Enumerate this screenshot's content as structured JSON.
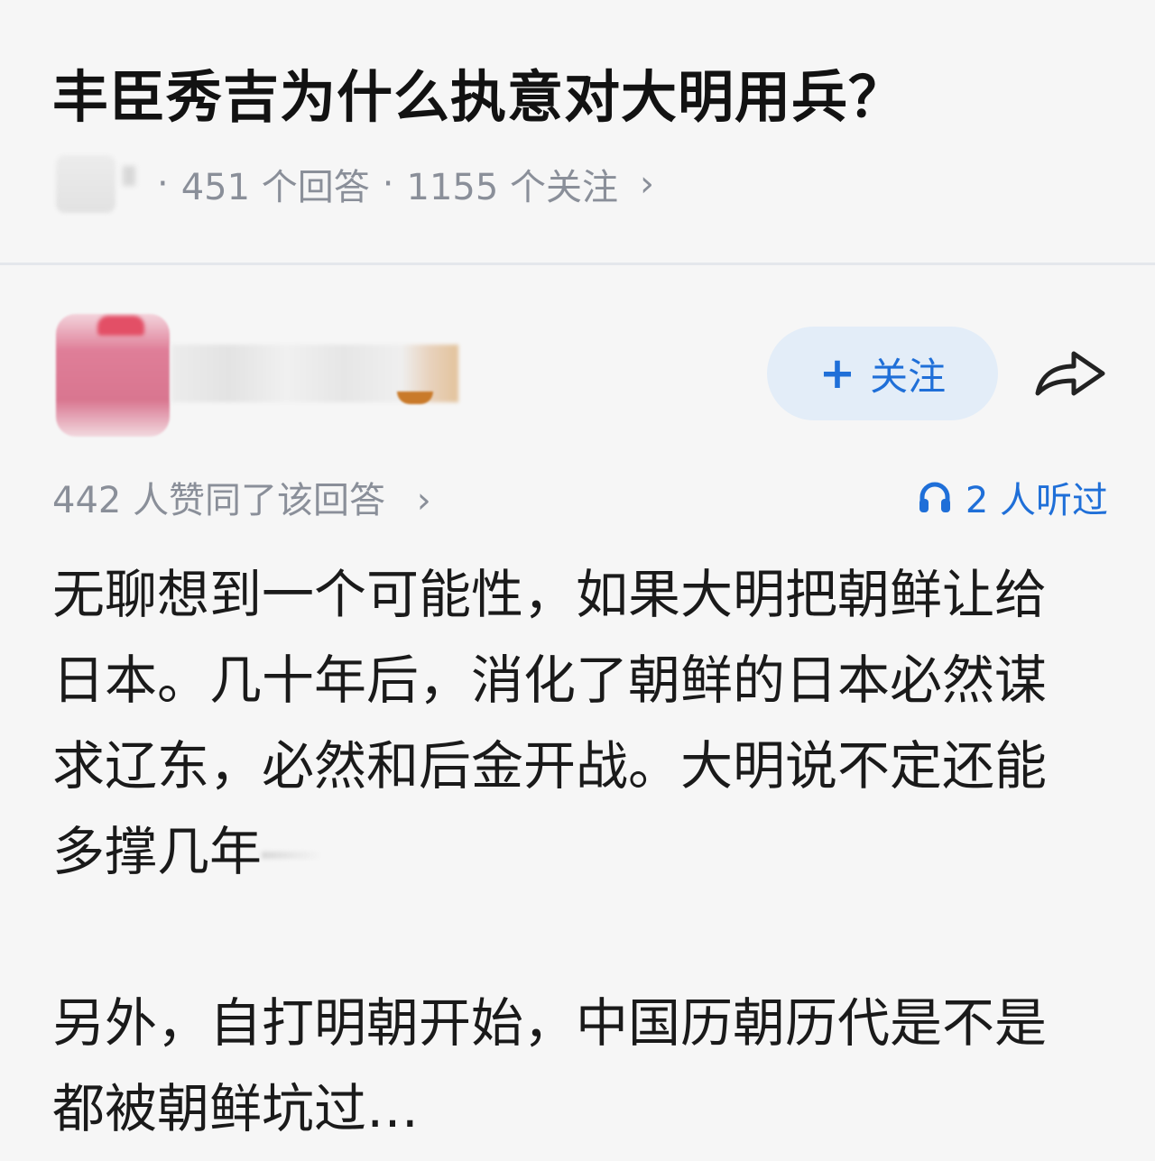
{
  "question": {
    "title": "丰臣秀吉为什么执意对大明用兵？",
    "answer_count": "451 个回答",
    "follow_count": "1155 个关注",
    "separator": "·",
    "chevron": "›"
  },
  "answer": {
    "follow_label": "关注",
    "likes_text": "442 人赞同了该回答",
    "likes_chevron": "›",
    "listened_text": "2 人听过",
    "paragraphs": [
      "无聊想到一个可能性，如果大明把朝鲜让给\n日本。几十年后，消化了朝鲜的日本必然谋\n求辽东，必然和后金开战。大明说不定还能\n多撑几年",
      "另外，自打明朝开始，中国历朝历代是不是\n都被朝鲜坑过…"
    ]
  },
  "colors": {
    "accent": "#1f6fd8",
    "follow_bg": "#e3edf8",
    "meta_text": "#8a8f99",
    "page_bg": "#f6f6f6"
  },
  "icons": {
    "share": "share-arrow-icon",
    "listen": "headphones-icon",
    "plus": "plus-icon"
  }
}
